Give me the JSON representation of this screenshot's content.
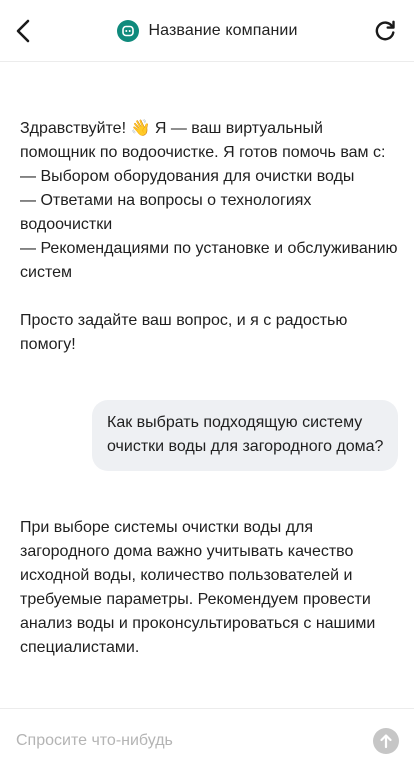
{
  "header": {
    "title": "Название компании",
    "back_icon": "chevron-left-icon",
    "refresh_icon": "refresh-icon",
    "logo_color": "#0f8a7c"
  },
  "messages": {
    "bot_greeting": {
      "intro": "Здравствуйте! 👋 Я — ваш виртуальный помощник по водоочистке. Я готов помочь вам с:",
      "items": [
        "— Выбором оборудования для очистки воды",
        "— Ответами на вопросы о технологиях водоочистки",
        "— Рекомендациями по установке и обслуживанию систем"
      ],
      "outro": "Просто задайте ваш вопрос, и я с радостью помогу!"
    },
    "user_question": "Как выбрать подходящую систему очистки воды для загородного дома?",
    "bot_answer": "При выборе системы очистки воды для загородного дома важно учитывать качество исходной воды, количество пользователей и требуемые параметры. Рекомендуем провести анализ воды и проконсультироваться с нашими специалистами."
  },
  "composer": {
    "placeholder": "Спросите что-нибудь",
    "value": "",
    "send_icon": "arrow-up-icon"
  },
  "colors": {
    "user_bubble": "#eef0f3",
    "send_button": "#c6c6c6",
    "brand": "#0f8a7c"
  }
}
